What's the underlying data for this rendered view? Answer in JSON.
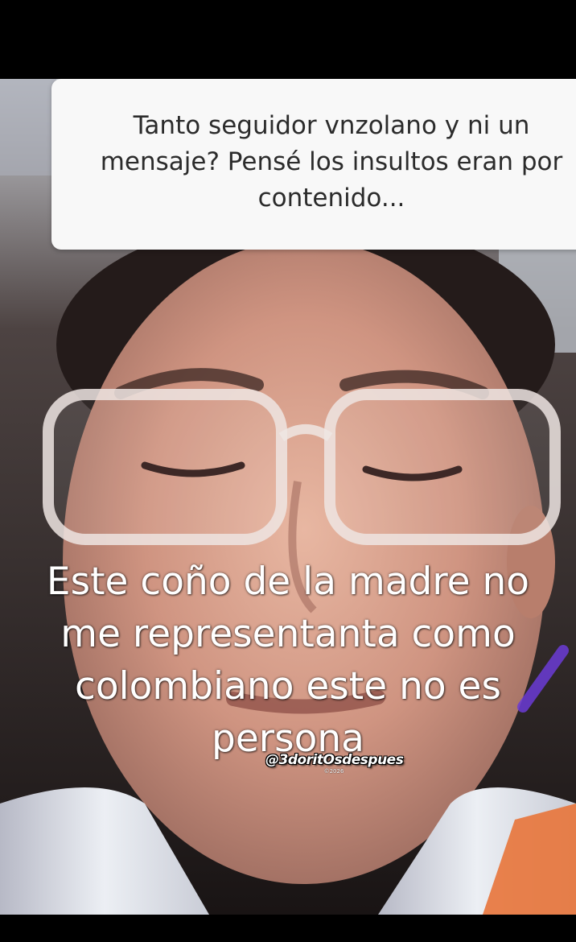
{
  "question_card": {
    "text": "Tanto seguidor vnzolano y ni un\nmensaje? Pensé los insultos eran por\ncontenido..."
  },
  "caption": {
    "text": "Este  coño de la madre no\nme representanta como\ncolombiano este no es\npersona"
  },
  "watermark": {
    "handle": "@3doritOsdespues",
    "year": "©2026"
  },
  "colors": {
    "background": "#000000",
    "card_background": "#f8f8f8",
    "card_text": "#2b2b2b",
    "caption_text": "#ffffff",
    "jacket_orange": "#e8743a"
  }
}
